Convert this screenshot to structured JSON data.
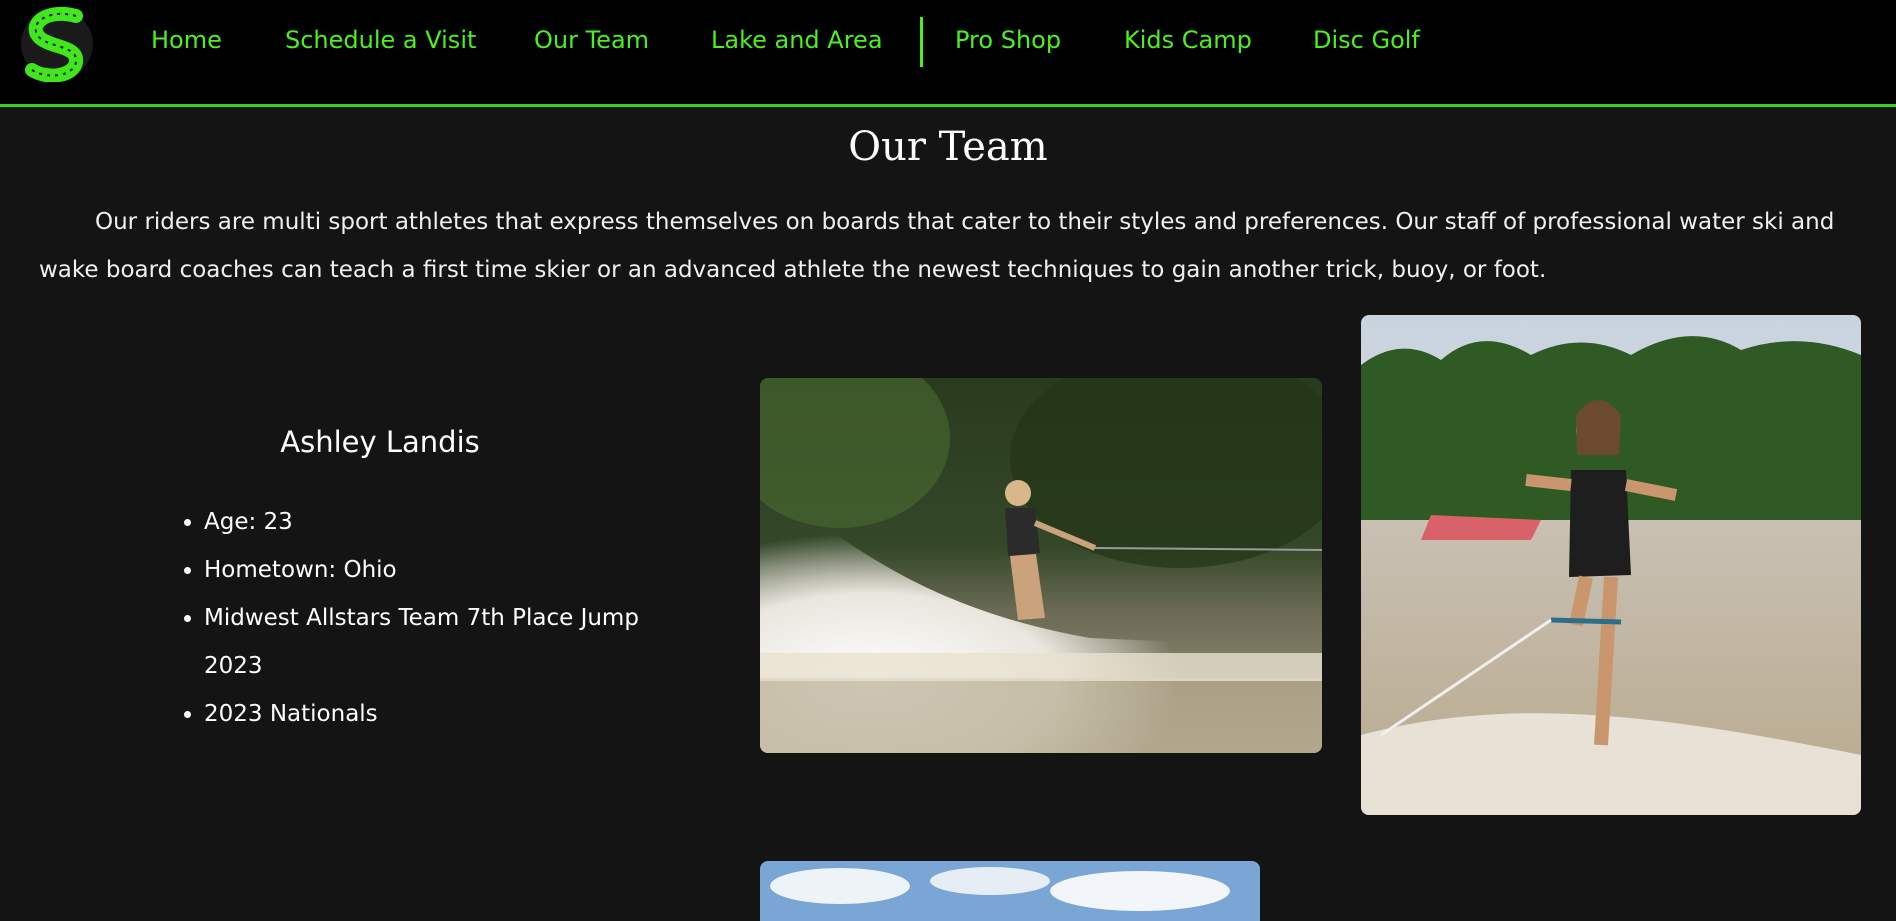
{
  "header": {
    "logo_icon": "swerve-waterski-center-logo",
    "accent_color": "#4cf01e",
    "nav": [
      {
        "label": "Home"
      },
      {
        "label": "Schedule a Visit"
      },
      {
        "label": "Our Team"
      },
      {
        "label": "Lake and Area"
      },
      {
        "label": "Pro Shop"
      },
      {
        "label": "Kids Camp"
      },
      {
        "label": "Disc Golf"
      }
    ]
  },
  "main": {
    "title": "Our Team",
    "intro": "Our riders are multi sport athletes that express themselves on boards that cater to their styles and preferences. Our staff of professional water ski and wake board coaches can teach a first time skier or an advanced athlete the newest techniques to gain another trick, buoy, or foot.",
    "member": {
      "name": "Ashley Landis",
      "facts": [
        "Age: 23",
        "Hometown: Ohio",
        "Midwest Allstars Team 7th Place Jump 2023",
        "2023 Nationals"
      ]
    }
  }
}
